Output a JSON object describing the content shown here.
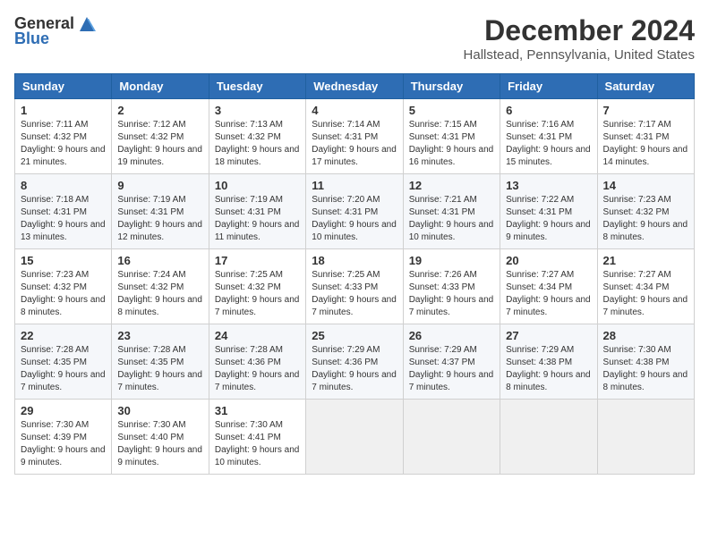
{
  "header": {
    "logo_general": "General",
    "logo_blue": "Blue",
    "month": "December 2024",
    "location": "Hallstead, Pennsylvania, United States"
  },
  "days_of_week": [
    "Sunday",
    "Monday",
    "Tuesday",
    "Wednesday",
    "Thursday",
    "Friday",
    "Saturday"
  ],
  "weeks": [
    [
      {
        "day": "1",
        "sunrise": "Sunrise: 7:11 AM",
        "sunset": "Sunset: 4:32 PM",
        "daylight": "Daylight: 9 hours and 21 minutes."
      },
      {
        "day": "2",
        "sunrise": "Sunrise: 7:12 AM",
        "sunset": "Sunset: 4:32 PM",
        "daylight": "Daylight: 9 hours and 19 minutes."
      },
      {
        "day": "3",
        "sunrise": "Sunrise: 7:13 AM",
        "sunset": "Sunset: 4:32 PM",
        "daylight": "Daylight: 9 hours and 18 minutes."
      },
      {
        "day": "4",
        "sunrise": "Sunrise: 7:14 AM",
        "sunset": "Sunset: 4:31 PM",
        "daylight": "Daylight: 9 hours and 17 minutes."
      },
      {
        "day": "5",
        "sunrise": "Sunrise: 7:15 AM",
        "sunset": "Sunset: 4:31 PM",
        "daylight": "Daylight: 9 hours and 16 minutes."
      },
      {
        "day": "6",
        "sunrise": "Sunrise: 7:16 AM",
        "sunset": "Sunset: 4:31 PM",
        "daylight": "Daylight: 9 hours and 15 minutes."
      },
      {
        "day": "7",
        "sunrise": "Sunrise: 7:17 AM",
        "sunset": "Sunset: 4:31 PM",
        "daylight": "Daylight: 9 hours and 14 minutes."
      }
    ],
    [
      {
        "day": "8",
        "sunrise": "Sunrise: 7:18 AM",
        "sunset": "Sunset: 4:31 PM",
        "daylight": "Daylight: 9 hours and 13 minutes."
      },
      {
        "day": "9",
        "sunrise": "Sunrise: 7:19 AM",
        "sunset": "Sunset: 4:31 PM",
        "daylight": "Daylight: 9 hours and 12 minutes."
      },
      {
        "day": "10",
        "sunrise": "Sunrise: 7:19 AM",
        "sunset": "Sunset: 4:31 PM",
        "daylight": "Daylight: 9 hours and 11 minutes."
      },
      {
        "day": "11",
        "sunrise": "Sunrise: 7:20 AM",
        "sunset": "Sunset: 4:31 PM",
        "daylight": "Daylight: 9 hours and 10 minutes."
      },
      {
        "day": "12",
        "sunrise": "Sunrise: 7:21 AM",
        "sunset": "Sunset: 4:31 PM",
        "daylight": "Daylight: 9 hours and 10 minutes."
      },
      {
        "day": "13",
        "sunrise": "Sunrise: 7:22 AM",
        "sunset": "Sunset: 4:31 PM",
        "daylight": "Daylight: 9 hours and 9 minutes."
      },
      {
        "day": "14",
        "sunrise": "Sunrise: 7:23 AM",
        "sunset": "Sunset: 4:32 PM",
        "daylight": "Daylight: 9 hours and 8 minutes."
      }
    ],
    [
      {
        "day": "15",
        "sunrise": "Sunrise: 7:23 AM",
        "sunset": "Sunset: 4:32 PM",
        "daylight": "Daylight: 9 hours and 8 minutes."
      },
      {
        "day": "16",
        "sunrise": "Sunrise: 7:24 AM",
        "sunset": "Sunset: 4:32 PM",
        "daylight": "Daylight: 9 hours and 8 minutes."
      },
      {
        "day": "17",
        "sunrise": "Sunrise: 7:25 AM",
        "sunset": "Sunset: 4:32 PM",
        "daylight": "Daylight: 9 hours and 7 minutes."
      },
      {
        "day": "18",
        "sunrise": "Sunrise: 7:25 AM",
        "sunset": "Sunset: 4:33 PM",
        "daylight": "Daylight: 9 hours and 7 minutes."
      },
      {
        "day": "19",
        "sunrise": "Sunrise: 7:26 AM",
        "sunset": "Sunset: 4:33 PM",
        "daylight": "Daylight: 9 hours and 7 minutes."
      },
      {
        "day": "20",
        "sunrise": "Sunrise: 7:27 AM",
        "sunset": "Sunset: 4:34 PM",
        "daylight": "Daylight: 9 hours and 7 minutes."
      },
      {
        "day": "21",
        "sunrise": "Sunrise: 7:27 AM",
        "sunset": "Sunset: 4:34 PM",
        "daylight": "Daylight: 9 hours and 7 minutes."
      }
    ],
    [
      {
        "day": "22",
        "sunrise": "Sunrise: 7:28 AM",
        "sunset": "Sunset: 4:35 PM",
        "daylight": "Daylight: 9 hours and 7 minutes."
      },
      {
        "day": "23",
        "sunrise": "Sunrise: 7:28 AM",
        "sunset": "Sunset: 4:35 PM",
        "daylight": "Daylight: 9 hours and 7 minutes."
      },
      {
        "day": "24",
        "sunrise": "Sunrise: 7:28 AM",
        "sunset": "Sunset: 4:36 PM",
        "daylight": "Daylight: 9 hours and 7 minutes."
      },
      {
        "day": "25",
        "sunrise": "Sunrise: 7:29 AM",
        "sunset": "Sunset: 4:36 PM",
        "daylight": "Daylight: 9 hours and 7 minutes."
      },
      {
        "day": "26",
        "sunrise": "Sunrise: 7:29 AM",
        "sunset": "Sunset: 4:37 PM",
        "daylight": "Daylight: 9 hours and 7 minutes."
      },
      {
        "day": "27",
        "sunrise": "Sunrise: 7:29 AM",
        "sunset": "Sunset: 4:38 PM",
        "daylight": "Daylight: 9 hours and 8 minutes."
      },
      {
        "day": "28",
        "sunrise": "Sunrise: 7:30 AM",
        "sunset": "Sunset: 4:38 PM",
        "daylight": "Daylight: 9 hours and 8 minutes."
      }
    ],
    [
      {
        "day": "29",
        "sunrise": "Sunrise: 7:30 AM",
        "sunset": "Sunset: 4:39 PM",
        "daylight": "Daylight: 9 hours and 9 minutes."
      },
      {
        "day": "30",
        "sunrise": "Sunrise: 7:30 AM",
        "sunset": "Sunset: 4:40 PM",
        "daylight": "Daylight: 9 hours and 9 minutes."
      },
      {
        "day": "31",
        "sunrise": "Sunrise: 7:30 AM",
        "sunset": "Sunset: 4:41 PM",
        "daylight": "Daylight: 9 hours and 10 minutes."
      },
      null,
      null,
      null,
      null
    ]
  ]
}
